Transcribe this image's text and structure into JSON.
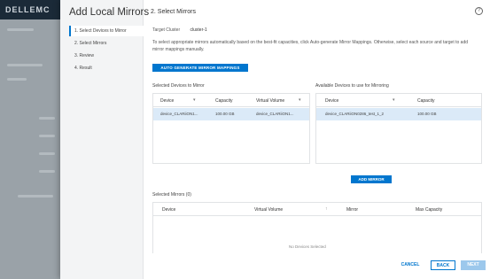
{
  "background": {
    "logo": "DELLEMC"
  },
  "dialog": {
    "title": "Add Local Mirrors",
    "steps": [
      {
        "label": "1. Select Devices to Mirror",
        "active": true
      },
      {
        "label": "2. Select Mirrors",
        "active": false
      },
      {
        "label": "3. Review",
        "active": false
      },
      {
        "label": "4. Result",
        "active": false
      }
    ],
    "step_heading": "2. Select Mirrors",
    "help_icon": "question-icon"
  },
  "target": {
    "label": "Target Cluster",
    "value": "cluster-1"
  },
  "instructions": "To select appropriate mirrors automatically based on the best-fit capacities, click Auto-generate Mirror Mappings. Otherwise, select each source and target to add mirror mappings manually.",
  "auto_button": "AUTO GENERATE MIRROR MAPPINGS",
  "selected_devices": {
    "label": "Selected Devices to Mirror",
    "columns": [
      "Device",
      "Capacity",
      "Virtual Volume"
    ],
    "rows": [
      {
        "device": "device_CLARiiON1...",
        "capacity": "100.00 GB",
        "volume": "device_CLARiiON1...",
        "selected": true
      }
    ]
  },
  "available_devices": {
    "label": "Available Devices to use for Mirroring",
    "columns": [
      "Device",
      "Capacity"
    ],
    "rows": [
      {
        "device": "device_CLARiiON0286_test_1_2",
        "capacity": "100.00 GB",
        "selected": true
      }
    ]
  },
  "add_mirror_button": "ADD MIRROR",
  "selected_mirrors": {
    "label": "Selected Mirrors (0)",
    "columns": [
      "Device",
      "Virtual Volume",
      "Mirror",
      "Max Capacity"
    ],
    "empty_text": "No Devices Selected"
  },
  "footer": {
    "cancel": "CANCEL",
    "back": "BACK",
    "next": "NEXT"
  }
}
